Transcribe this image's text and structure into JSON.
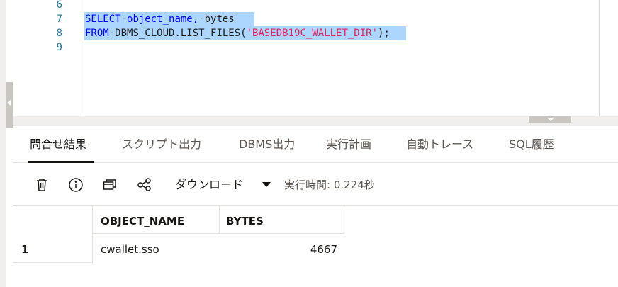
{
  "editor": {
    "lines": [
      {
        "no": "6",
        "text": ""
      },
      {
        "no": "7",
        "tokens": [
          "SELECT",
          "object_name,",
          "bytes"
        ]
      },
      {
        "no": "8",
        "tokens": [
          "FROM",
          "DBMS_CLOUD.LIST_FILES(",
          "'BASEDB19C_WALLET_DIR'",
          ");"
        ]
      },
      {
        "no": "9",
        "text": ""
      }
    ]
  },
  "tabs": [
    {
      "label": "問合せ結果",
      "active": true
    },
    {
      "label": "スクリプト出力",
      "active": false
    },
    {
      "label": "DBMS出力",
      "active": false
    },
    {
      "label": "実行計画",
      "active": false
    },
    {
      "label": "自動トレース",
      "active": false
    },
    {
      "label": "SQL履歴",
      "active": false
    }
  ],
  "toolbar": {
    "icons": [
      "trash-icon",
      "info-icon",
      "window-icon",
      "share-icon"
    ],
    "download_label": "ダウンロード",
    "exec_time": "実行時間: 0.224秒"
  },
  "results": {
    "columns": [
      "OBJECT_NAME",
      "BYTES"
    ],
    "rows": [
      {
        "row_no": "1",
        "object_name": "cwallet.sso",
        "bytes": "4667"
      }
    ]
  },
  "colors": {
    "keyword": "#0000ff",
    "string": "#e0245e",
    "line_number": "#237893",
    "selection": "#add6ff"
  }
}
